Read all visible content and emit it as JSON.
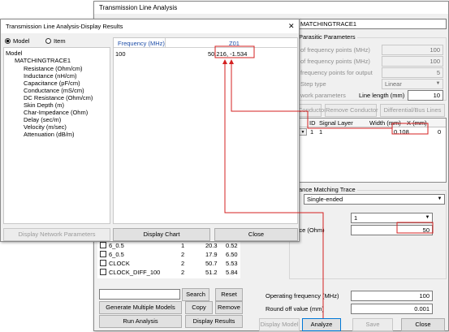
{
  "back_window": {
    "title": "Transmission Line Analysis",
    "trace_name": "MATCHINGTRACE1",
    "parasitic_group_title": "Parasitic Parameters",
    "rows": [
      {
        "label": "of frequency points (MHz)",
        "value": "100"
      },
      {
        "label": "of frequency points (MHz)",
        "value": "100"
      },
      {
        "label": "frequency points for output",
        "value": "5"
      }
    ],
    "step_type_label": "Step type",
    "step_type_value": "Linear",
    "network_params_label": "work parameters",
    "line_length_label": "Line length (mm)",
    "line_length_value": "10",
    "buttons_mid": {
      "conductor": "Conductor",
      "remove_conductor": "Remove Conductor",
      "differential": "Differential/Bus Lines"
    },
    "table_headers": {
      "id": "ID",
      "signal_layer": "Signal Layer",
      "width": "Width (mm)",
      "x": "X (mm)"
    },
    "table_row": {
      "id": "1",
      "signal_layer": "1",
      "width": "0.108",
      "x": "0"
    },
    "impedance_group_title": "ance Matching Trace",
    "mode_value": "Single-ended",
    "layer_value": "1",
    "impedance_label": "ance (Ohm)",
    "impedance_value": "50",
    "operating_freq_label": "Operating frequency (MHz)",
    "operating_freq_value": "100",
    "round_off_label": "Round off value (mm)",
    "round_off_value": "0.001",
    "bottom_buttons": {
      "display_model": "Display Model",
      "analyze": "Analyze",
      "save": "Save",
      "close": "Close"
    },
    "model_list": [
      {
        "name": "6_0.5",
        "n": "1",
        "a": "20.3",
        "b": "0.52"
      },
      {
        "name": "6_0.5",
        "n": "2",
        "a": "17.9",
        "b": "6.50"
      },
      {
        "name": "CLOCK",
        "n": "2",
        "a": "50.7",
        "b": "5.53"
      },
      {
        "name": "CLOCK_DIFF_100",
        "n": "2",
        "a": "51.2",
        "b": "5.84"
      }
    ],
    "left_buttons": {
      "search": "Search",
      "reset": "Reset",
      "generate": "Generate Multiple Models",
      "copy": "Copy",
      "remove": "Remove",
      "run": "Run Analysis",
      "display_results": "Display Results"
    }
  },
  "front_window": {
    "title": "Transmission Line Analysis-Display Results",
    "close_glyph": "✕",
    "radio_model": "Model",
    "radio_item": "Item",
    "tree_root": "Model",
    "tree_trace": "MATCHINGTRACE1",
    "tree_items": [
      "Resistance (Ohm/cm)",
      "Inductance (nH/cm)",
      "Capacitance (pF/cm)",
      "Conductance (mS/cm)",
      "DC Resistance (Ohm/cm)",
      "Skin Depth (m)",
      "Char-Impedance (Ohm)",
      "Delay (sec/m)",
      "Velocity (m/sec)",
      "Attenuation (dB/m)"
    ],
    "grid_headers": [
      "Frequency (MHz)",
      "Z01"
    ],
    "grid_row": [
      "100",
      "50.216, -1.534"
    ],
    "buttons": {
      "network": "Display Network Parameters",
      "chart": "Display Chart",
      "close": "Close"
    }
  }
}
